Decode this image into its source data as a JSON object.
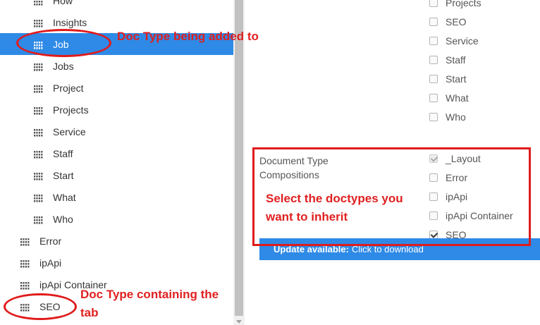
{
  "tree": {
    "items": [
      {
        "label": "How",
        "level": 1
      },
      {
        "label": "Insights",
        "level": 1
      },
      {
        "label": "Job",
        "level": 1,
        "active": true
      },
      {
        "label": "Jobs",
        "level": 1
      },
      {
        "label": "Project",
        "level": 1
      },
      {
        "label": "Projects",
        "level": 1
      },
      {
        "label": "Service",
        "level": 1
      },
      {
        "label": "Staff",
        "level": 1
      },
      {
        "label": "Start",
        "level": 1
      },
      {
        "label": "What",
        "level": 1
      },
      {
        "label": "Who",
        "level": 1
      },
      {
        "label": "Error",
        "level": 0
      },
      {
        "label": "ipApi",
        "level": 0
      },
      {
        "label": "ipApi Container",
        "level": 0
      },
      {
        "label": "SEO",
        "level": 0
      }
    ]
  },
  "allowed_children": {
    "items": [
      {
        "label": "Projects",
        "checked": false
      },
      {
        "label": "SEO",
        "checked": false
      },
      {
        "label": "Service",
        "checked": false
      },
      {
        "label": "Staff",
        "checked": false
      },
      {
        "label": "Start",
        "checked": false
      },
      {
        "label": "What",
        "checked": false
      },
      {
        "label": "Who",
        "checked": false
      }
    ]
  },
  "compositions": {
    "label": "Document Type Compositions",
    "items": [
      {
        "label": "_Layout",
        "checked": true,
        "disabled": true
      },
      {
        "label": "Error",
        "checked": false
      },
      {
        "label": "ipApi",
        "checked": false
      },
      {
        "label": "ipApi Container",
        "checked": false
      },
      {
        "label": "SEO",
        "checked": true
      }
    ]
  },
  "update_bar": {
    "bold": "Update available:",
    "text": "Click to download"
  },
  "annotations": {
    "job_note": "Doc Type being added to",
    "select_note_line1": "Select the doctypes you",
    "select_note_line2": "want to inherit",
    "seo_note_line1": "Doc Type containing the",
    "seo_note_line2": "tab"
  },
  "colors": {
    "active_bg": "#2e8ae6",
    "annotation": "#e01b1b"
  }
}
